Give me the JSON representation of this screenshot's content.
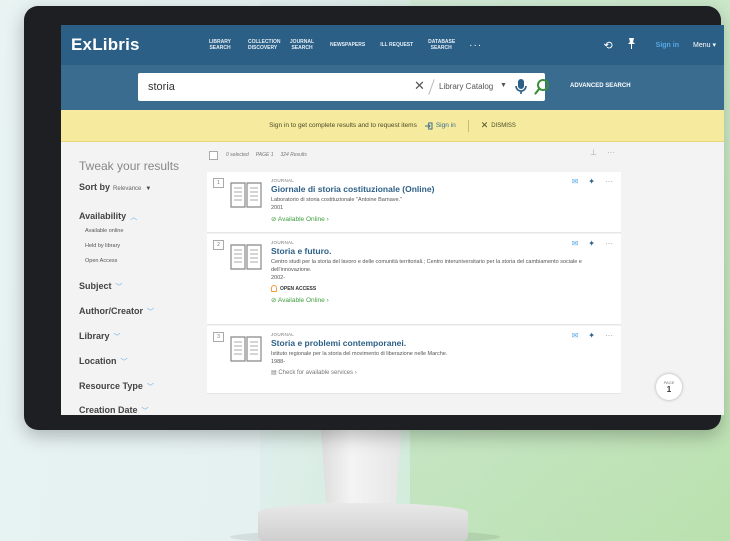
{
  "brand": "ExLibris",
  "nav": [
    {
      "label": "LIBRARY SEARCH"
    },
    {
      "label": "COLLECTION DISCOVERY"
    },
    {
      "label": "JOURNAL SEARCH"
    },
    {
      "label": "NEWSPAPERS"
    },
    {
      "label": "ILL REQUEST"
    },
    {
      "label": "DATABASE SEARCH"
    }
  ],
  "nav_more": "···",
  "top_right": {
    "signin": "Sign in",
    "menu": "Menu"
  },
  "search": {
    "query": "storia",
    "clear": "✕",
    "scope": "Library Catalog",
    "advanced": "ADVANCED SEARCH"
  },
  "banner": {
    "text": "Sign in to get complete results and to request items",
    "signin": "Sign in",
    "dismiss": "DISMISS"
  },
  "facets": {
    "tweak": "Tweak your results",
    "sort_by": "Sort by",
    "sort_value": "Relevance",
    "availability": "Availability",
    "availability_items": [
      "Available online",
      "Held by library",
      "Open Access"
    ],
    "subject": "Subject",
    "author": "Author/Creator",
    "library": "Library",
    "location": "Location",
    "resource_type": "Resource Type",
    "creation_date": "Creation Date"
  },
  "results_toolbar": {
    "selected": "0 selected",
    "page": "PAGE 1",
    "count": "324 Results"
  },
  "results": [
    {
      "num": "1",
      "type": "JOURNAL",
      "title": "Giornale di storia costituzionale (Online)",
      "author": "Laboratorio di storia costituzionale \"Antoine Barnave.\"",
      "year": "2001",
      "open_access": "",
      "availability": "Available Online",
      "avail_style": "online"
    },
    {
      "num": "2",
      "type": "JOURNAL",
      "title": "Storia e futuro.",
      "author": "Centro studi per la storia del lavoro e delle comunità territoriali.; Centro interuniversitario per la storia del cambiamento sociale e dell'innovazione.",
      "year": "2002-",
      "open_access": "OPEN ACCESS",
      "availability": "Available Online",
      "avail_style": "online"
    },
    {
      "num": "3",
      "type": "JOURNAL",
      "title": "Storia e problemi contemporanei.",
      "author": "Istituto regionale per la storia del movimento di liberazione nelle Marche.",
      "year": "1988-",
      "open_access": "",
      "availability": "Check for available services",
      "avail_style": "check"
    }
  ],
  "page_badge": {
    "label": "PAGE",
    "value": "1"
  },
  "colors": {
    "header": "#2c5f86",
    "searchbar": "#3a6c90",
    "banner": "#f5ea9d",
    "link": "#2c5f86",
    "available": "#3e9e3e",
    "accent": "#56a9e6"
  }
}
